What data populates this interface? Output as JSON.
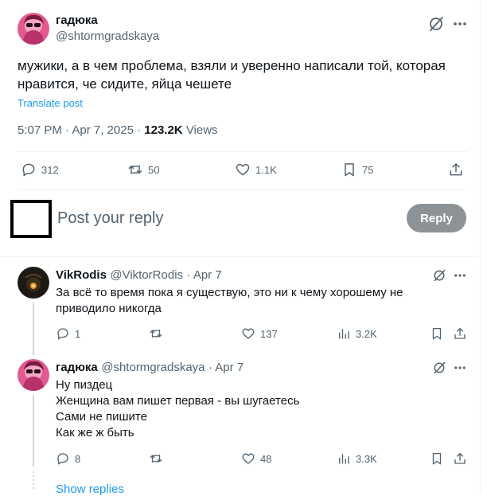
{
  "main_tweet": {
    "author_name": "гадюка",
    "author_handle": "@shtormgradskaya",
    "text": "мужики, а в чем проблема, взяли и уверенно написали той, которая нравится, че сидите, яйца чешете",
    "translate_label": "Translate post",
    "time": "5:07 PM · Apr 7, 2025",
    "separator": " · ",
    "views_count": "123.2K",
    "views_label": "Views",
    "replies": "312",
    "reposts": "50",
    "likes": "1.1K",
    "bookmarks": "75"
  },
  "reply_composer": {
    "placeholder": "Post your reply",
    "button_label": "Reply"
  },
  "replies": [
    {
      "author_name": "VikRodis",
      "author_handle": "@ViktorRodis",
      "date": "· Apr 7",
      "text": "За всё то время пока я существую, это ни к чему хорошему не приводило никогда",
      "replies": "1",
      "likes": "137",
      "views": "3.2K"
    },
    {
      "author_name": "гадюка",
      "author_handle": "@shtormgradskaya",
      "date": "· Apr 7",
      "lines": [
        "Ну пиздец",
        "Женщина вам пишет первая - вы шугаетесь",
        "Сами не пишите",
        "Как же ж быть"
      ],
      "replies": "8",
      "likes": "48",
      "views": "3.3K"
    }
  ],
  "show_replies_label": "Show replies",
  "colors": {
    "accent": "#1d9bf0",
    "muted": "#536471",
    "reply_button": "#8d9296"
  }
}
